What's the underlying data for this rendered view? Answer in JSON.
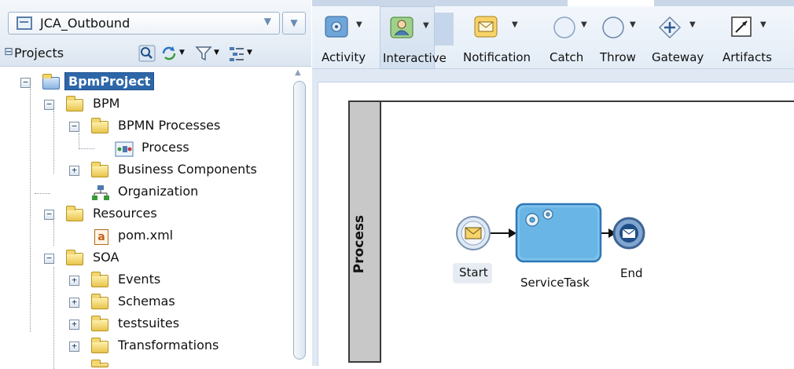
{
  "navigator": {
    "application": "JCA_Outbound",
    "projects_label": "Projects",
    "tree": [
      {
        "label": "BpmProject",
        "selected": true
      },
      {
        "label": "BPM"
      },
      {
        "label": "BPMN Processes"
      },
      {
        "label": "Process"
      },
      {
        "label": "Business Components"
      },
      {
        "label": "Organization"
      },
      {
        "label": "Resources"
      },
      {
        "label": "pom.xml"
      },
      {
        "label": "SOA"
      },
      {
        "label": "Events"
      },
      {
        "label": "Schemas"
      },
      {
        "label": "testsuites"
      },
      {
        "label": "Transformations"
      }
    ]
  },
  "palette": {
    "items": [
      {
        "label": "Activity",
        "icon": "activity-icon"
      },
      {
        "label": "Interactive",
        "icon": "user-task-icon"
      },
      {
        "label": "Notification",
        "icon": "envelope-icon"
      },
      {
        "label": "Catch",
        "icon": "catch-event-icon"
      },
      {
        "label": "Throw",
        "icon": "throw-event-icon"
      },
      {
        "label": "Gateway",
        "icon": "gateway-icon"
      },
      {
        "label": "Artifacts",
        "icon": "artifacts-icon"
      }
    ]
  },
  "canvas": {
    "lane_title": "Process",
    "nodes": {
      "start": "Start",
      "task": "ServiceTask",
      "end": "End"
    }
  },
  "colors": {
    "accent": "#4f86c6",
    "selection": "#2e67a8",
    "lane": "#c8c8c8"
  }
}
